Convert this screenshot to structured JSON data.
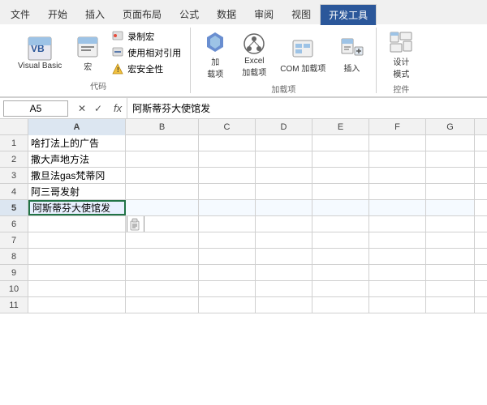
{
  "tabs": [
    {
      "label": "文件",
      "active": false,
      "highlight": false
    },
    {
      "label": "开始",
      "active": false,
      "highlight": false
    },
    {
      "label": "插入",
      "active": false,
      "highlight": false
    },
    {
      "label": "页面布局",
      "active": false,
      "highlight": false
    },
    {
      "label": "公式",
      "active": false,
      "highlight": false
    },
    {
      "label": "数据",
      "active": false,
      "highlight": false
    },
    {
      "label": "审阅",
      "active": false,
      "highlight": false
    },
    {
      "label": "视图",
      "active": false,
      "highlight": false
    },
    {
      "label": "开发工具",
      "active": true,
      "highlight": true
    }
  ],
  "ribbon": {
    "groups": [
      {
        "label": "代码",
        "buttons": [
          {
            "id": "visual-basic",
            "icon": "📊",
            "label": "Visual Basic"
          },
          {
            "id": "macro",
            "icon": "⏺",
            "label": "宏"
          }
        ],
        "smallButtons": [
          {
            "id": "record-macro",
            "icon": "⏺",
            "label": "录制宏"
          },
          {
            "id": "relative-ref",
            "icon": "📎",
            "label": "使用相对引用"
          },
          {
            "id": "macro-security",
            "icon": "⚠",
            "label": "宏安全性"
          }
        ]
      },
      {
        "label": "加载项",
        "buttons": [
          {
            "id": "add-in",
            "icon": "🔷",
            "label": "加\n载项"
          },
          {
            "id": "excel-addin",
            "icon": "⚙",
            "label": "Excel\n加载项"
          },
          {
            "id": "com-addin",
            "icon": "📋",
            "label": "COM 加载项"
          },
          {
            "id": "insert",
            "icon": "🧰",
            "label": "插入"
          }
        ]
      }
    ]
  },
  "formula_bar": {
    "cell_ref": "A5",
    "formula": "阿斯蒂芬大使馆发",
    "fx_label": "fx"
  },
  "columns": [
    "A",
    "B",
    "C",
    "D",
    "E",
    "F",
    "G"
  ],
  "rows": [
    {
      "num": 1,
      "a": "啥打法上的广告",
      "b": "",
      "c": "",
      "d": "",
      "e": "",
      "f": "",
      "g": ""
    },
    {
      "num": 2,
      "a": "撒大声地方法",
      "b": "",
      "c": "",
      "d": "",
      "e": "",
      "f": "",
      "g": ""
    },
    {
      "num": 3,
      "a": "    撒旦法gas梵蒂冈",
      "b": "",
      "c": "",
      "d": "",
      "e": "",
      "f": "",
      "g": ""
    },
    {
      "num": 4,
      "a": "阿三哥发射",
      "b": "",
      "c": "",
      "d": "",
      "e": "",
      "f": "",
      "g": ""
    },
    {
      "num": 5,
      "a": "阿斯蒂芬大使馆发",
      "b": "",
      "c": "",
      "d": "",
      "e": "",
      "f": "",
      "g": "",
      "active": true
    },
    {
      "num": 6,
      "a": "",
      "b": "paste",
      "c": "",
      "d": "",
      "e": "",
      "f": "",
      "g": ""
    },
    {
      "num": 7,
      "a": "",
      "b": "",
      "c": "",
      "d": "",
      "e": "",
      "f": "",
      "g": ""
    },
    {
      "num": 8,
      "a": "",
      "b": "",
      "c": "",
      "d": "",
      "e": "",
      "f": "",
      "g": ""
    },
    {
      "num": 9,
      "a": "",
      "b": "",
      "c": "",
      "d": "",
      "e": "",
      "f": "",
      "g": ""
    },
    {
      "num": 10,
      "a": "",
      "b": "",
      "c": "",
      "d": "",
      "e": "",
      "f": "",
      "g": ""
    },
    {
      "num": 11,
      "a": "",
      "b": "",
      "c": "",
      "d": "",
      "e": "",
      "f": "",
      "g": ""
    }
  ]
}
